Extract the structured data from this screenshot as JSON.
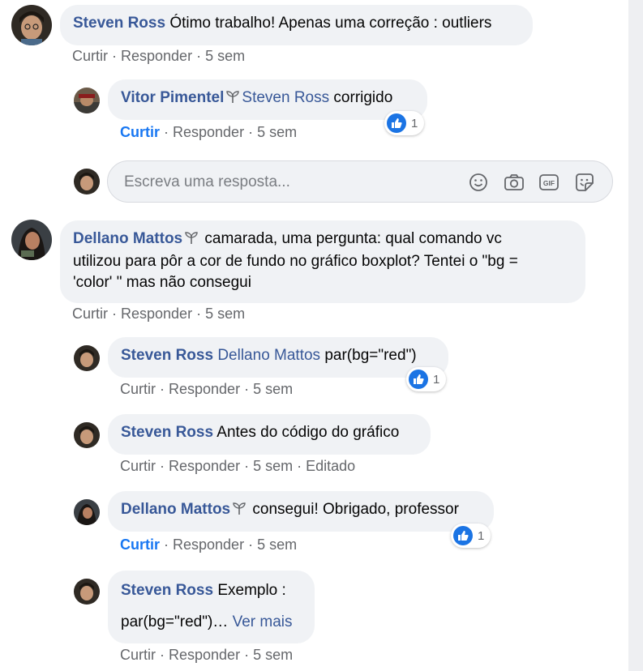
{
  "comments": [
    {
      "author": "Steven Ross",
      "text": "Ótimo trabalho! Apenas uma correção : outliers",
      "meta": {
        "like": "Curtir",
        "reply": "Responder",
        "time": "5 sem"
      }
    },
    {
      "author": "Vitor Pimentel",
      "mention": "Steven Ross",
      "text": "corrigido",
      "reactions": "1",
      "meta": {
        "like": "Curtir",
        "reply": "Responder",
        "time": "5 sem"
      }
    },
    {
      "author": "Dellano Mattos",
      "text_line1": "camarada, uma pergunta: qual comando vc",
      "text_line2": "utilizou para pôr a cor de fundo no gráfico boxplot? Tentei o \"bg =",
      "text_line3": "'color' \" mas não consegui",
      "meta": {
        "like": "Curtir",
        "reply": "Responder",
        "time": "5 sem"
      }
    },
    {
      "author": "Steven Ross",
      "mention": "Dellano Mattos",
      "text": "par(bg=\"red\")",
      "reactions": "1",
      "meta": {
        "like": "Curtir",
        "reply": "Responder",
        "time": "5 sem"
      }
    },
    {
      "author": "Steven Ross",
      "text": "Antes do código do gráfico",
      "meta": {
        "like": "Curtir",
        "reply": "Responder",
        "time": "5 sem",
        "edited": "Editado"
      }
    },
    {
      "author": "Dellano Mattos",
      "text": "consegui! Obrigado, professor",
      "reactions": "1",
      "meta": {
        "like": "Curtir",
        "reply": "Responder",
        "time": "5 sem"
      }
    },
    {
      "author": "Steven Ross",
      "text": "Exemplo :",
      "text_line2": "par(bg=\"red\")…",
      "see_more": "Ver mais",
      "meta": {
        "like": "Curtir",
        "reply": "Responder",
        "time": "5 sem"
      }
    }
  ],
  "reply_box": {
    "placeholder": "Escreva uma resposta...",
    "tools": [
      "emoji-icon",
      "camera-icon",
      "gif-icon",
      "sticker-icon"
    ]
  },
  "colors": {
    "author": "#385898",
    "active_like": "#1877f2",
    "bubble": "#f0f2f5",
    "meta": "#65676b",
    "like_badge": "#1b74e4"
  }
}
